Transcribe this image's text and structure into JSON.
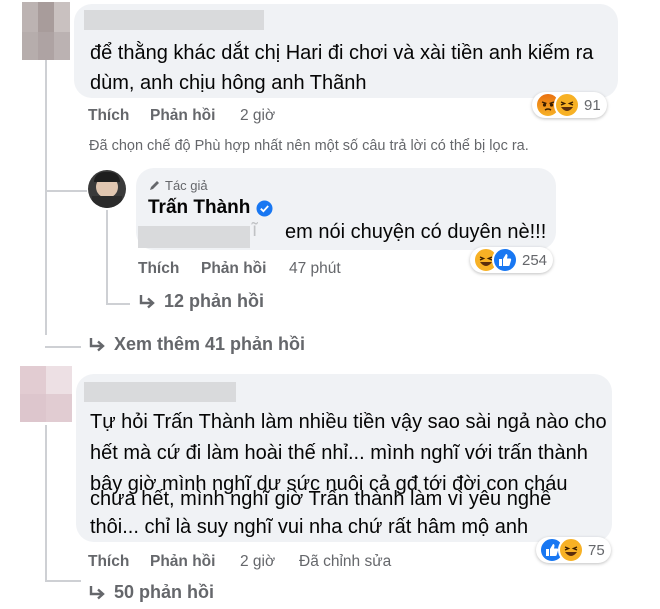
{
  "colors": {
    "bubble": "#f0f2f5",
    "secondary_text": "#65676b",
    "verified": "#1877f2",
    "like_blue": "#1877f2",
    "emoji_yellow": "#f7b125",
    "angry_red": "#e9710f"
  },
  "comment1": {
    "text_line1": "để thằng khác dắt chị Hari đi chơi và xài tiền anh kiếm ra",
    "text_line2": "dùm, anh chịu hông anh Thãnh",
    "like_label": "Thích",
    "reply_label": "Phản hồi",
    "time": "2 giờ",
    "reaction_icons": [
      "angry-icon",
      "haha-icon"
    ],
    "reaction_count": "91"
  },
  "filter_note": "Đã chọn chế độ Phù hợp nhất nên một số câu trả lời có thể bị lọc ra.",
  "reply1": {
    "badge": "Tác giả",
    "author": "Trấn Thành",
    "verified_icon": "verified-badge-icon",
    "redacted_tail": "ĩ",
    "text": "em nói chuyện có duyên nè!!!",
    "like_label": "Thích",
    "reply_label": "Phản hồi",
    "time": "47 phút",
    "reaction_icons": [
      "haha-icon",
      "like-icon"
    ],
    "reaction_count": "254",
    "replies_link": "12 phản hồi"
  },
  "more_replies_link": "Xem thêm 41 phản hồi",
  "comment2": {
    "lines": [
      "Tự hỏi Trấn Thành làm nhiều tiền vậy sao sài ngả nào cho",
      "hết mà cứ đi làm hoài thế nhỉ... mình nghĩ với trấn thành",
      "bây giờ mình nghĩ dư sức nuôi cả gđ tới đời con cháu",
      "chưa hết, mình nghĩ giờ Trấn thành làm vì yêu nghề",
      "thôi... chỉ là suy nghĩ vui nha chứ rất hâm mộ anh"
    ],
    "like_label": "Thích",
    "reply_label": "Phản hồi",
    "time": "2 giờ",
    "edited": "Đã chỉnh sửa",
    "reaction_icons": [
      "like-icon",
      "haha-icon"
    ],
    "reaction_count": "75",
    "replies_link": "50 phản hồi"
  }
}
